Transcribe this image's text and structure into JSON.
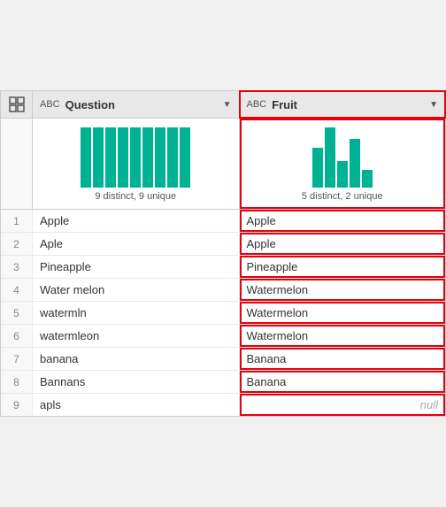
{
  "header": {
    "grid_icon": "⊞",
    "col1": {
      "type_icon": "ABC",
      "label": "Question",
      "dropdown": "▼"
    },
    "col2": {
      "type_icon": "ABC",
      "label": "Fruit",
      "dropdown": "▼"
    }
  },
  "profile": {
    "col1": {
      "label": "9 distinct, 9 unique",
      "bars": [
        68,
        68,
        68,
        68,
        68,
        68,
        68,
        68,
        68
      ]
    },
    "col2": {
      "label": "5 distinct, 2 unique",
      "bars": [
        45,
        68,
        30,
        55,
        20
      ]
    }
  },
  "rows": [
    {
      "num": "1",
      "question": "Apple",
      "fruit": "Apple"
    },
    {
      "num": "2",
      "question": "Aple",
      "fruit": "Apple"
    },
    {
      "num": "3",
      "question": "Pineapple",
      "fruit": "Pineapple"
    },
    {
      "num": "4",
      "question": "Water melon",
      "fruit": "Watermelon"
    },
    {
      "num": "5",
      "question": "watermln",
      "fruit": "Watermelon"
    },
    {
      "num": "6",
      "question": "watermleon",
      "fruit": "Watermelon"
    },
    {
      "num": "7",
      "question": "banana",
      "fruit": "Banana"
    },
    {
      "num": "8",
      "question": "Bannans",
      "fruit": "Banana"
    },
    {
      "num": "9",
      "question": "apls",
      "fruit": "null"
    }
  ],
  "colors": {
    "teal": "#00b294",
    "red_border": "#e8000d",
    "header_bg": "#e8e8e8"
  }
}
